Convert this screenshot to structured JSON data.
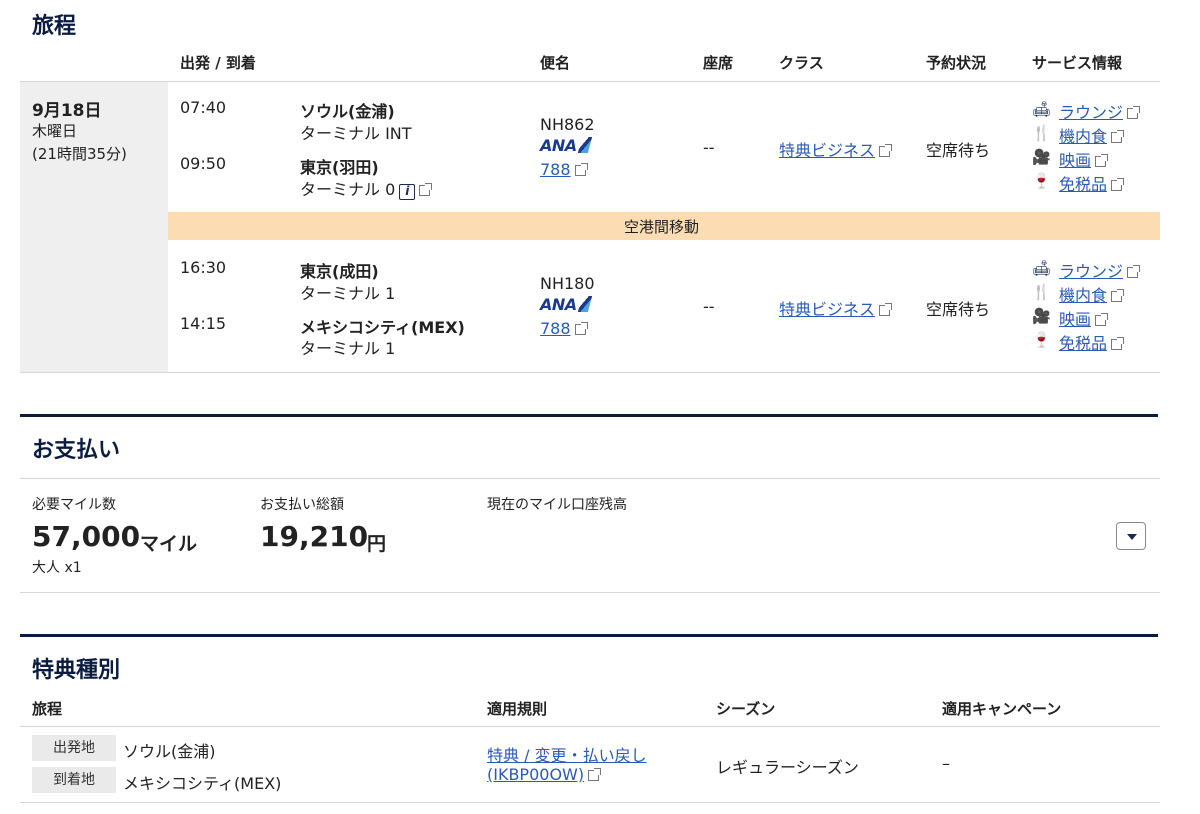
{
  "itinerary": {
    "title": "旅程",
    "headers": {
      "depart_arrive": "出発 / 到着",
      "flight": "便名",
      "seat": "座席",
      "class": "クラス",
      "status": "予約状況",
      "service": "サービス情報"
    },
    "date": {
      "day": "9月18日",
      "weekday": "木曜日",
      "duration": "(21時間35分)"
    },
    "segments": [
      {
        "dep_time": "07:40",
        "dep_city": "ソウル(金浦)",
        "dep_terminal": "ターミナル INT",
        "arr_time": "09:50",
        "arr_city": "東京(羽田)",
        "arr_terminal": "ターミナル 0",
        "flight_no": "NH862",
        "airline": "ANA",
        "aircraft": "788",
        "seat": "--",
        "cabin": "特典ビジネス",
        "status": "空席待ち",
        "services": [
          "ラウンジ",
          "機内食",
          "映画",
          "免税品"
        ]
      },
      {
        "dep_time": "16:30",
        "dep_city": "東京(成田)",
        "dep_terminal": "ターミナル 1",
        "arr_time": "14:15",
        "arr_city": "メキシコシティ(MEX)",
        "arr_terminal": "ターミナル 1",
        "flight_no": "NH180",
        "airline": "ANA",
        "aircraft": "788",
        "seat": "--",
        "cabin": "特典ビジネス",
        "status": "空席待ち",
        "services": [
          "ラウンジ",
          "機内食",
          "映画",
          "免税品"
        ]
      }
    ],
    "transfer_label": "空港間移動"
  },
  "payment": {
    "title": "お支払い",
    "miles_label": "必要マイル数",
    "miles_value": "57,000",
    "miles_unit": "マイル",
    "passengers": "大人 x1",
    "total_label": "お支払い総額",
    "total_value": "19,210",
    "total_unit": "円",
    "balance_label": "現在のマイル口座残高"
  },
  "award": {
    "title": "特典種別",
    "headers": {
      "itinerary": "旅程",
      "rule": "適用規則",
      "season": "シーズン",
      "campaign": "適用キャンペーン"
    },
    "origin_tag": "出発地",
    "origin": "ソウル(金浦)",
    "dest_tag": "到着地",
    "dest": "メキシコシティ(MEX)",
    "rule_line1": "特典 / 変更・払い戻し",
    "rule_line2": "(IKBP00OW)",
    "season": "レギュラーシーズン",
    "campaign": "–"
  },
  "icons": {
    "lounge": "lounge-icon",
    "meal": "meal-icon",
    "movie": "movie-icon",
    "dutyfree": "duty-free-icon",
    "info": "info-icon",
    "external": "external-link-icon",
    "dropdown": "chevron-down-icon"
  }
}
